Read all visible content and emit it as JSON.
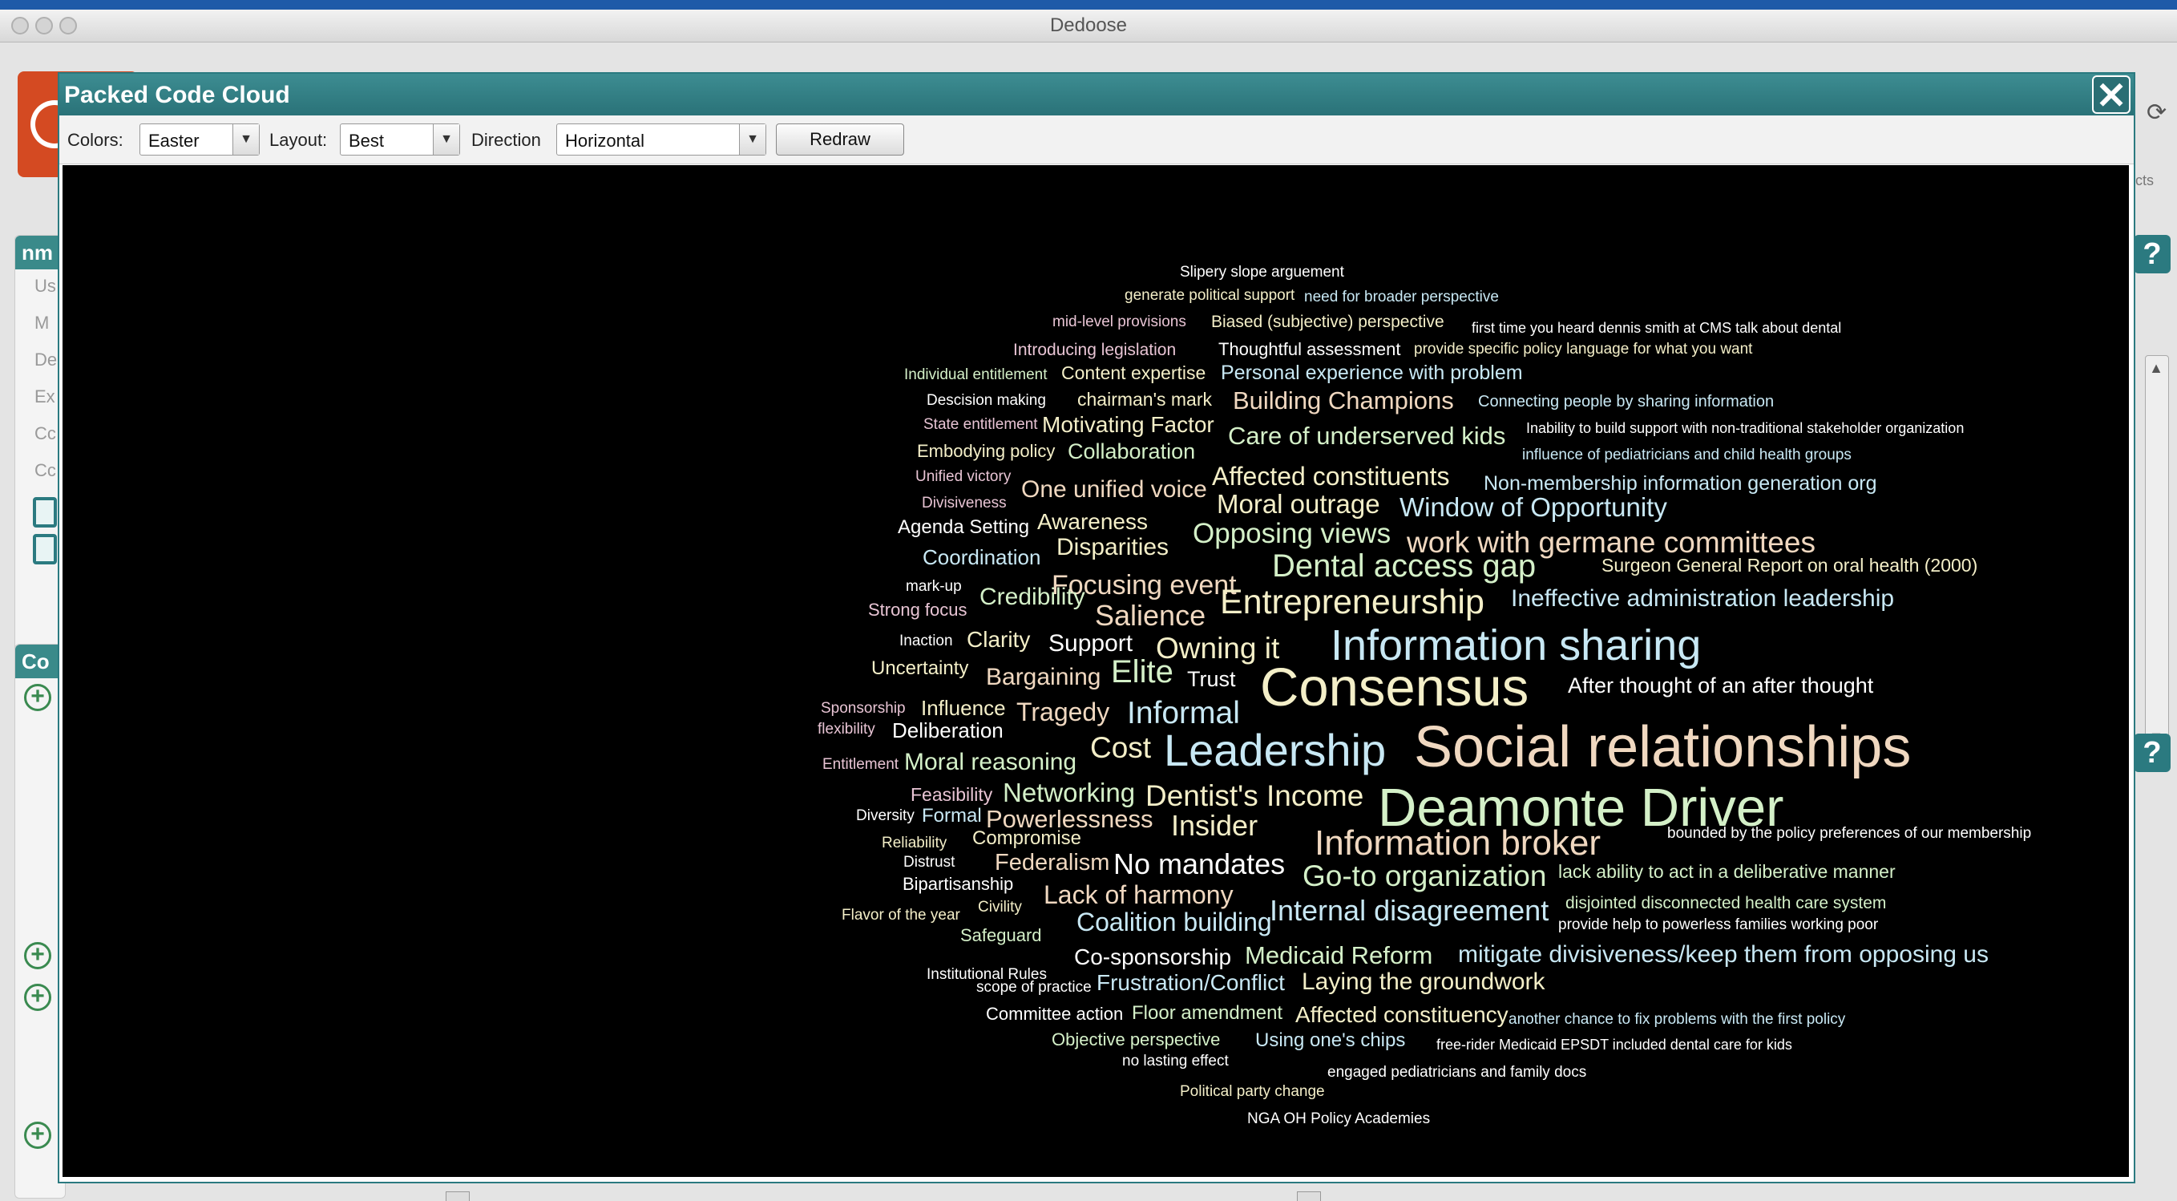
{
  "window": {
    "title": "Dedoose"
  },
  "background_app": {
    "left_panel_1_header": "nm",
    "left_panel_1_letters": [
      "Us",
      "M",
      "De",
      "Ex",
      "Cc",
      "Cc"
    ],
    "left_panel_2_header": "Co",
    "right_label": "cts"
  },
  "dialog": {
    "title": "Packed Code Cloud",
    "close_label": "✕",
    "toolbar": {
      "colors_label": "Colors:",
      "colors_value": "Easter",
      "layout_label": "Layout:",
      "layout_value": "Best",
      "direction_label": "Direction",
      "direction_value": "Horizontal",
      "redraw_label": "Redraw"
    }
  },
  "colors": {
    "teal": "#2b7a80",
    "canvas": "#000000",
    "word_palette": [
      "#e8c4d4",
      "#f4efc8",
      "#c8e8f4",
      "#d4f0c8",
      "#f0d8c0",
      "#ffffff"
    ]
  },
  "cloud_words": [
    "Slipery slope arguement",
    "generate political support",
    "need for broader perspective",
    "mid-level provisions",
    "Biased (subjective) perspective",
    "first time you heard dennis smith at CMS talk about dental",
    "Introducing legislation",
    "Thoughtful assessment",
    "provide specific policy language for what you want",
    "Individual entitlement",
    "Content expertise",
    "Personal experience with problem",
    "Descision making",
    "chairman's mark",
    "Building Champions",
    "Connecting people by sharing information",
    "State entitlement",
    "Motivating Factor",
    "Care of underserved kids",
    "Inability to build support with non-traditional stakeholder organization",
    "Embodying policy",
    "Collaboration",
    "influence of pediatricians and child health groups",
    "Unified victory",
    "Affected constituents",
    "One unified voice",
    "Non-membership information generation org",
    "Divisiveness",
    "Moral outrage",
    "Window of Opportunity",
    "Agenda Setting",
    "Awareness",
    "Opposing views",
    "work with germane committees",
    "Disparities",
    "Coordination",
    "Dental access gap",
    "Surgeon General Report on oral health (2000)",
    "Focusing event",
    "mark-up",
    "Credibility",
    "Entrepreneurship",
    "Ineffective administration leadership",
    "Strong focus",
    "Salience",
    "Inaction",
    "Clarity",
    "Support",
    "Owning it",
    "Information sharing",
    "Uncertainty",
    "Bargaining",
    "Elite",
    "Trust",
    "Consensus",
    "After thought of an after thought",
    "Sponsorship",
    "Influence",
    "Tragedy",
    "Informal",
    "flexibility",
    "Deliberation",
    "Social relationships",
    "Cost",
    "Leadership",
    "Entitlement",
    "Moral reasoning",
    "Feasibility",
    "Networking",
    "Dentist's Income",
    "Deamonte Driver",
    "Diversity",
    "Formal",
    "Powerlessness",
    "Insider",
    "bounded by the policy preferences of our membership",
    "Compromise",
    "Information broker",
    "Reliability",
    "Distrust",
    "Federalism",
    "No mandates",
    "Go-to organization",
    "lack ability to act in a deliberative manner",
    "Bipartisanship",
    "Lack of harmony",
    "Civility",
    "Internal disagreement",
    "disjointed disconnected health care system",
    "Flavor of the year",
    "Coalition building",
    "provide help to powerless families working poor",
    "Safeguard",
    "Co-sponsorship",
    "Medicaid Reform",
    "mitigate divisiveness/keep them from opposing us",
    "Institutional Rules",
    "scope of practice",
    "Frustration/Conflict",
    "Laying the groundwork",
    "Committee action",
    "Floor amendment",
    "Affected constituency",
    "another chance to fix problems with the first policy",
    "Objective perspective",
    "Using one's chips",
    "free-rider Medicaid EPSDT included dental care for kids",
    "no lasting effect",
    "engaged pediatricians and family docs",
    "Political party change",
    "NGA OH Policy Academies"
  ]
}
